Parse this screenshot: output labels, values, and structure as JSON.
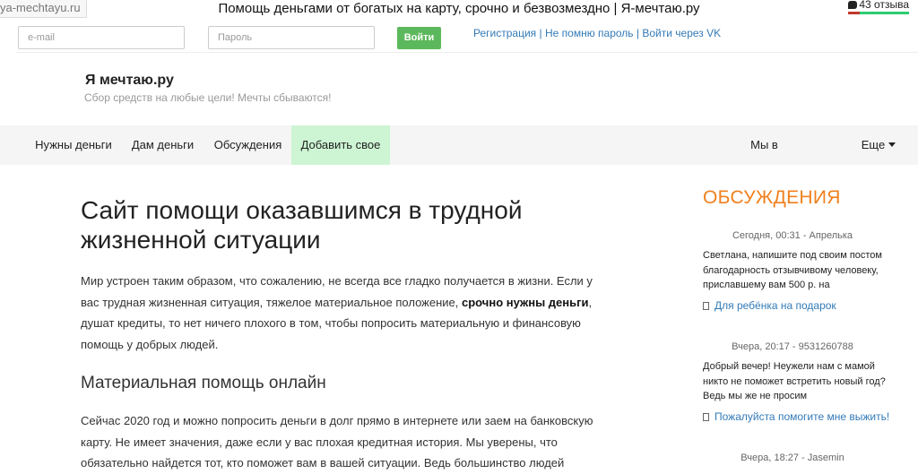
{
  "window": {
    "site_tag": "ya-mechtayu.ru",
    "title": "Помощь деньгами от богатых на карту, срочно и безвозмездно | Я-мечтаю.ру",
    "reviews": "43 отзыва"
  },
  "login": {
    "email_placeholder": "e-mail",
    "password_placeholder": "Пароль",
    "submit_label": "Войти",
    "link_register": "Регистрация",
    "link_forgot": "Не помню пароль",
    "link_vk": "Войти через VK",
    "separator": "|"
  },
  "brand": {
    "name": "Я мечтаю.ру",
    "tagline": "Сбор средств на любые цели! Мечты сбываются!"
  },
  "nav": {
    "items": [
      "Нужны деньги",
      "Дам деньги",
      "Обсуждения",
      "Добавить свое"
    ],
    "right_item": "Мы в",
    "more": "Еще"
  },
  "article": {
    "title": "Сайт помощи оказавшимся в трудной жизненной ситуации",
    "para1_before": "Мир устроен таким образом, что сожалению, не всегда все гладко получается в жизни. Если у вас трудная жизненная ситуация, тяжелое материальное положение, ",
    "para1_bold": "срочно нужны деньги",
    "para1_after": ", душат кредиты, то нет ничего плохого в том, чтобы попросить материальную и финансовую помощь у добрых людей.",
    "subtitle": "Материальная помощь онлайн",
    "para2": "Сейчас 2020 год и можно попросить деньги в долг прямо в интернете или заем на банковскую карту. Не имеет значения, даже если у вас плохая кредитная история. Мы уверены, что обязательно найдется тот, кто поможет вам в вашей ситуации. Ведь большинство людей"
  },
  "sidebar": {
    "title": "ОБСУЖДЕНИЯ",
    "comments": [
      {
        "meta": "Сегодня, 00:31 - Апрелька",
        "text": "Светлана, напишите под своим постом благодарность отзывчивому человеку, приславшему вам 500 р. на",
        "link": "Для ребёнка на подарок"
      },
      {
        "meta": "Вчера, 20:17 - 9531260788",
        "text": "Добрый вечер! Неужели нам с мамой никто не поможет встретить новый год? Ведь мы же не просим",
        "link": "Пожалуйста помогите мне выжить!"
      },
      {
        "meta": "Вчера, 18:27 - Jasemin",
        "text": "",
        "link": ""
      }
    ]
  }
}
